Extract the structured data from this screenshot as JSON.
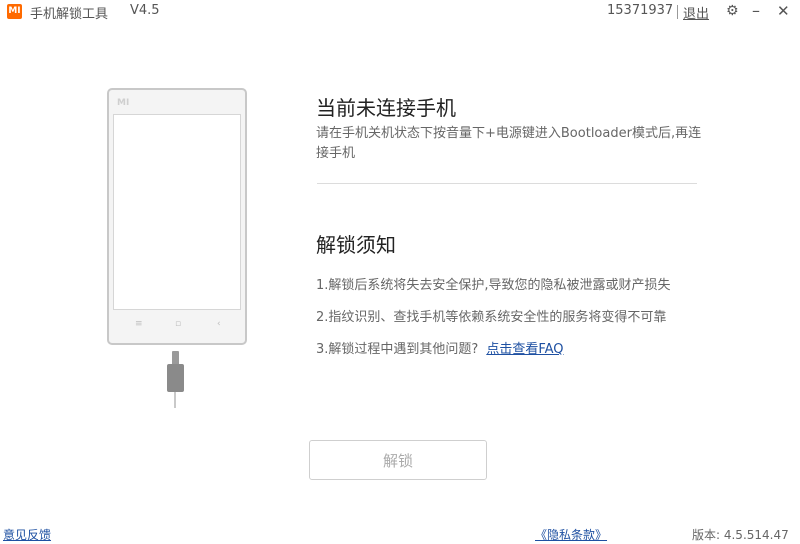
{
  "titlebar": {
    "logo": "MI",
    "app_title": "手机解锁工具",
    "version": "V4.5",
    "account_id": "15371937",
    "logout": "退出",
    "settings_icon": "gear-icon",
    "minimize_icon": "minimize-icon",
    "close_icon": "close-icon"
  },
  "phone": {
    "brand": "MI",
    "menu_button": "≡",
    "home_button": "▫",
    "back_button": "‹"
  },
  "status": {
    "title": "当前未连接手机",
    "hint": "请在手机关机状态下按音量下+电源键进入Bootloader模式后,再连接手机"
  },
  "notice": {
    "title": "解锁须知",
    "items": [
      "1.解锁后系统将失去安全保护,导致您的隐私被泄露或财产损失",
      "2.指纹识别、查找手机等依赖系统安全性的服务将变得不可靠",
      "3.解锁过程中遇到其他问题?"
    ],
    "faq_link": "点击查看FAQ"
  },
  "action": {
    "unlock_label": "解锁"
  },
  "footer": {
    "feedback": "意见反馈",
    "privacy": "《隐私条款》",
    "version": "版本: 4.5.514.47"
  },
  "colors": {
    "brand": "#ff6a00",
    "link": "#1e50a2"
  }
}
